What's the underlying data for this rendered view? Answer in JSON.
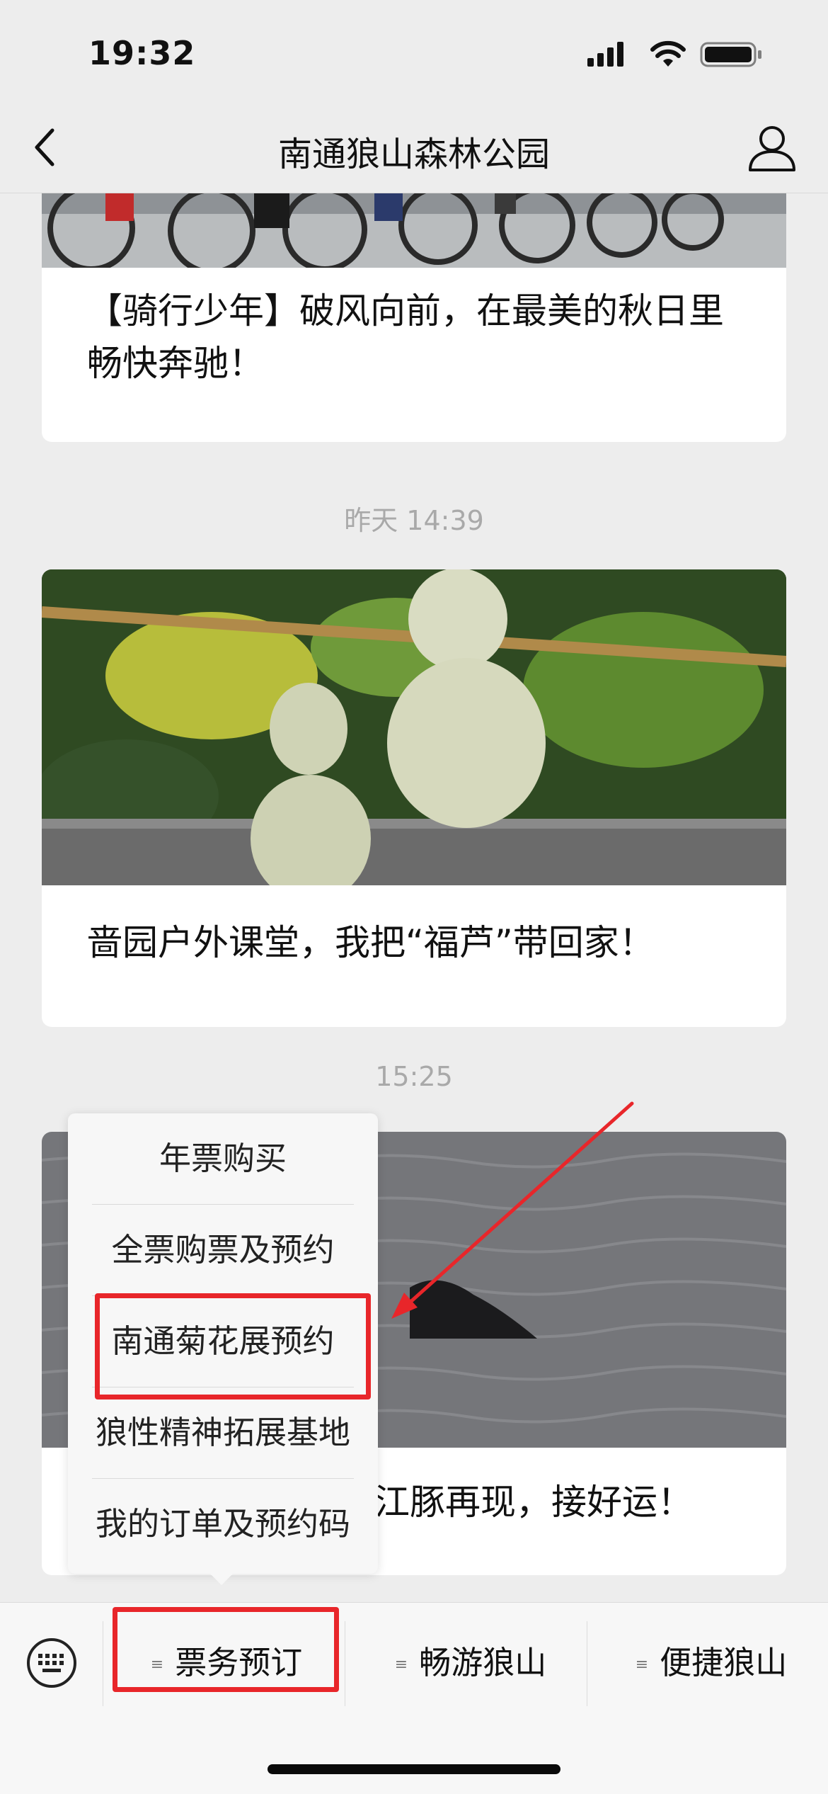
{
  "status_bar": {
    "time": "19:32"
  },
  "nav": {
    "title": "南通狼山森林公园"
  },
  "feed": {
    "articles": [
      {
        "title": "【骑行少年】破风向前，在最美的秋日里畅快奔驰！"
      },
      {
        "timestamp": "昨天 14:39",
        "title": "啬园户外课堂，我把“福芦”带回家！"
      },
      {
        "timestamp": "15:25",
        "title_partial": "江豚再现，接好运！"
      }
    ]
  },
  "popup_menu": {
    "items": [
      "年票购买",
      "全票购票及预约",
      "南通菊花展预约",
      "狼性精神拓展基地",
      "我的订单及预约码"
    ],
    "highlighted_index": 2
  },
  "bottom_menu": {
    "tabs": [
      "票务预订",
      "畅游狼山",
      "便捷狼山"
    ],
    "active_index": 0
  },
  "colors": {
    "annotation": "#e8262a",
    "background": "#ededed"
  }
}
